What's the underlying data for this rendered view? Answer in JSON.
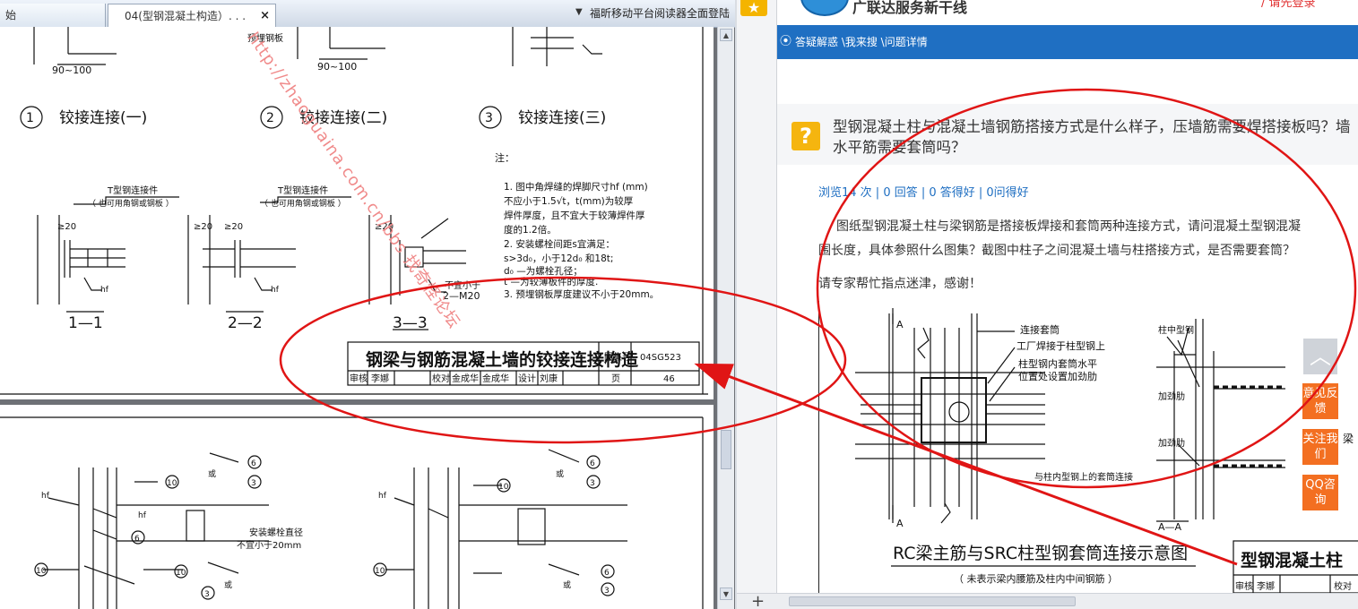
{
  "reader": {
    "tabs": [
      {
        "label": "始"
      },
      {
        "label": "04(型钢混凝土构造）. . ."
      }
    ],
    "tab_close": "×",
    "dropdown": "▼",
    "promo": "福昕移动平台阅读器全面登陆"
  },
  "drawing_top": {
    "dims": [
      "90~100",
      "90~100"
    ],
    "preembed_label": "预埋钢板",
    "details": [
      {
        "num": "1",
        "label": "铰接连接(一)"
      },
      {
        "num": "2",
        "label": "铰接连接(二)"
      },
      {
        "num": "3",
        "label": "铰接连接(三)"
      }
    ],
    "connector_label": "T型钢连接件",
    "connector_sub": "（ 也可用角钢或钢板 ）",
    "weld_mark": "hf",
    "dim20": "≥20",
    "bolt_note_a": "不宜小于",
    "bolt_note_b": "2—M20",
    "sections": [
      "1—1",
      "2—2",
      "3—3"
    ],
    "notes_title": "注：",
    "notes": [
      "1. 图中角焊缝的焊脚尺寸hf (mm)",
      "   不应小于1.5√t，t(mm)为较厚",
      "   焊件厚度，且不宜大于较薄焊件厚",
      "   度的1.2倍。",
      "2. 安装螺栓间距s宜满足：",
      "   s>3d₀，小于12d₀ 和18t;",
      "   d₀ —为螺栓孔径；",
      "   t —为较薄板件的厚度.",
      "3. 预埋钢板厚度建议不小于20mm。"
    ],
    "title_block": {
      "title": "钢梁与钢筋混凝土墙的铰接连接构造",
      "atlas_label": "图集号",
      "atlas_no": "04SG523",
      "page_label": "页",
      "page_no": "46",
      "row2": [
        "审核",
        "李娜",
        "校对",
        "金成华",
        "金成华",
        "设计",
        "刘康"
      ]
    },
    "watermark": "http://zhaoguaina.com.cn/bbs 找奇怪论坛"
  },
  "drawing_bottom": {
    "circles": [
      "6",
      "3",
      "10",
      "6",
      "3",
      "10",
      "10"
    ],
    "or_label": "或",
    "bolt_label_a": "安装螺栓直径",
    "bolt_label_b": "不宜小于20mm",
    "weld_mark": "hf"
  },
  "browser": {
    "slogan": "广联达服务新干线",
    "login": "/ 请先登录",
    "breadcrumb": "答疑解惑 \\我来搜 \\问题详情",
    "question_icon": "?",
    "question_title": "型钢混凝土柱与混凝土墙钢筋搭接方式是什么样子，压墙筋需要焊搭接板吗？墙水平筋需要套筒吗？",
    "stats": "浏览14 次 | 0 回答 | 0 答得好 | 0问得好",
    "body_lines": [
      "图纸型钢混凝土柱与梁钢筋是搭接板焊接和套筒两种连接方式，请问混凝土型钢混凝",
      "围长度，具体参照什么图集？截图中柱子之间混凝土墙与柱搭接方式，是否需要套筒？"
    ],
    "plea": "请专家帮忙指点迷津，感谢！",
    "attachment": {
      "label_a": "A",
      "sleeve_label": "连接套筒",
      "factory_weld": "工厂焊接于柱型钢上",
      "stiffener_a": "柱型钢内套筒水平",
      "stiffener_b": "位置处设置加劲肋",
      "col_steel": "柱中型钢",
      "stiffener": "加劲肋",
      "sleeve_conn": "与柱内型钢上的套筒连接",
      "section": "A—A",
      "caption": "RC梁主筋与SRC柱型钢套筒连接示意图",
      "caption_sub": "（ 未表示梁内腰筋及柱内中间钢筋 ）",
      "right_title": "型钢混凝土柱",
      "right_row": [
        "审核",
        "李娜",
        "校对"
      ],
      "right_mark": "梁"
    },
    "side_buttons": {
      "top": "︿",
      "feedback": "意见反馈",
      "follow": "关注我们",
      "qq": "QQ咨询"
    },
    "plus": "+"
  },
  "colors": {
    "annotation": "#e01515",
    "accent": "#1f6fc2",
    "side": "#f36f21",
    "question": "#f5b50f"
  }
}
